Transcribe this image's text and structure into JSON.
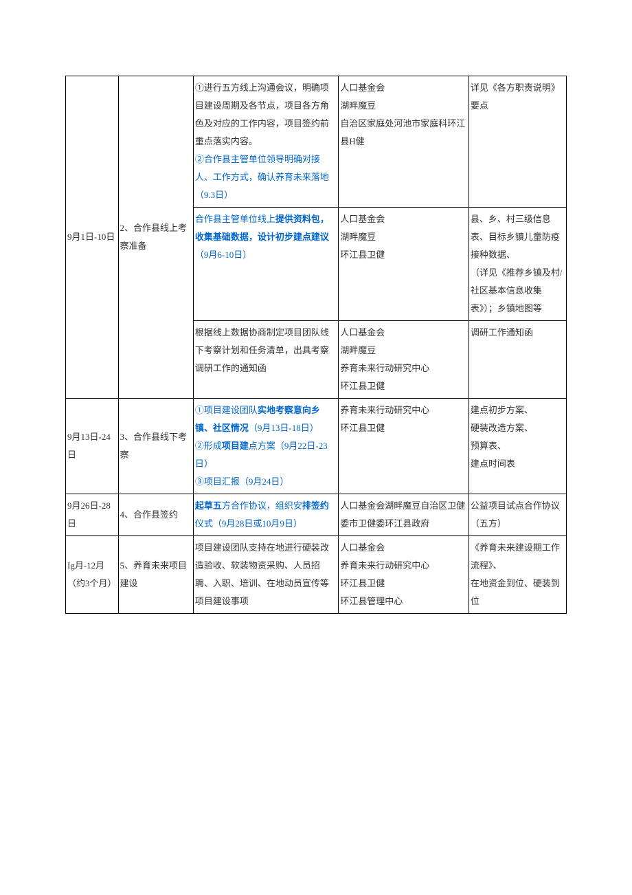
{
  "rows": [
    {
      "date": "9月1日-10日",
      "stage": "2、合作县线上考察准备",
      "tasks": [
        {
          "desc_plain": "①进行五方线上沟通会议，明确项目建设周期及各节点，项目各方角色及对应的工作内容，项目签约前重点落实内容。",
          "desc_highlight": "②合作县主管单位领导明确对接人、工作方式，确认养育未来落地（9.3日）",
          "party": "人口基金会\n湖畔魔豆\n自治区家庭处河池市家庭科环江县H健",
          "output": "详见《各方职责说明》要点"
        },
        {
          "desc_prefix": "合作县主管单位线上",
          "desc_bold": "提供资料包，收集基础数据，设计初步建点建议",
          "desc_suffix": "（9月6-10日）",
          "party": "人口基金会\n湖畔魔豆\n环江县卫健",
          "output": "县、乡、村三级信息表、目标乡镇儿童防疫接种数据、\n（详见《推荐乡镇及村/社区基本信息收集表》）；乡镇地图等"
        },
        {
          "desc_plain": "根据线上数据协商制定项目团队线下考察计划和任务清单，出具考察调研工作的通知函",
          "party": "人口基金会\n湖畔魔豆\n养育未来行动研究中心\n环江县卫健",
          "output": "调研工作通知函"
        }
      ]
    },
    {
      "date": "9月13日-24日",
      "stage": "3、合作县线下考察",
      "tasks": [
        {
          "line1_prefix": "①项目建设团队",
          "line1_bold": "实地考察意向乡镇、社区情况",
          "line1_suffix": "（9月13日-18日）",
          "line2_prefix": "②形成",
          "line2_bold": "项目建",
          "line2_suffix": "点方案（9月22日-23日）",
          "line3": "③项目汇报（9月24日）",
          "party": "养育未来行动研究中心\n环江县卫健",
          "output": "建点初步方案、\n硬装改造方案、\n预算表、\n建点时间表"
        }
      ]
    },
    {
      "date": "9月26日-28日",
      "stage": "4、合作县签约",
      "tasks": [
        {
          "desc_bold1": "起草五",
          "desc_mid": "方合作协议，组织安",
          "desc_bold2": "排签约",
          "desc_suffix": "仪式（9月28日或10月9日）",
          "party": "人口基金会湖畔魔豆自治区卫健委市卫健委环江县政府",
          "output": "公益项目试点合作协议（五方）"
        }
      ]
    },
    {
      "date": "Ig月-12月（约3个月）",
      "stage": "5、养育未来项目建设",
      "tasks": [
        {
          "desc_plain": "项目建设团队支持在地进行硬装改造验收、软装物资采购、人员招聘、入职、培训、在地动员宣传等项目建设事项",
          "party": "人口基金会\n养育未来行动研究中心\n环江县卫健\n环江县管理中心",
          "output": "《养育未来建设期工作流程》、\n在地资金到位、硬装到位"
        }
      ]
    }
  ]
}
